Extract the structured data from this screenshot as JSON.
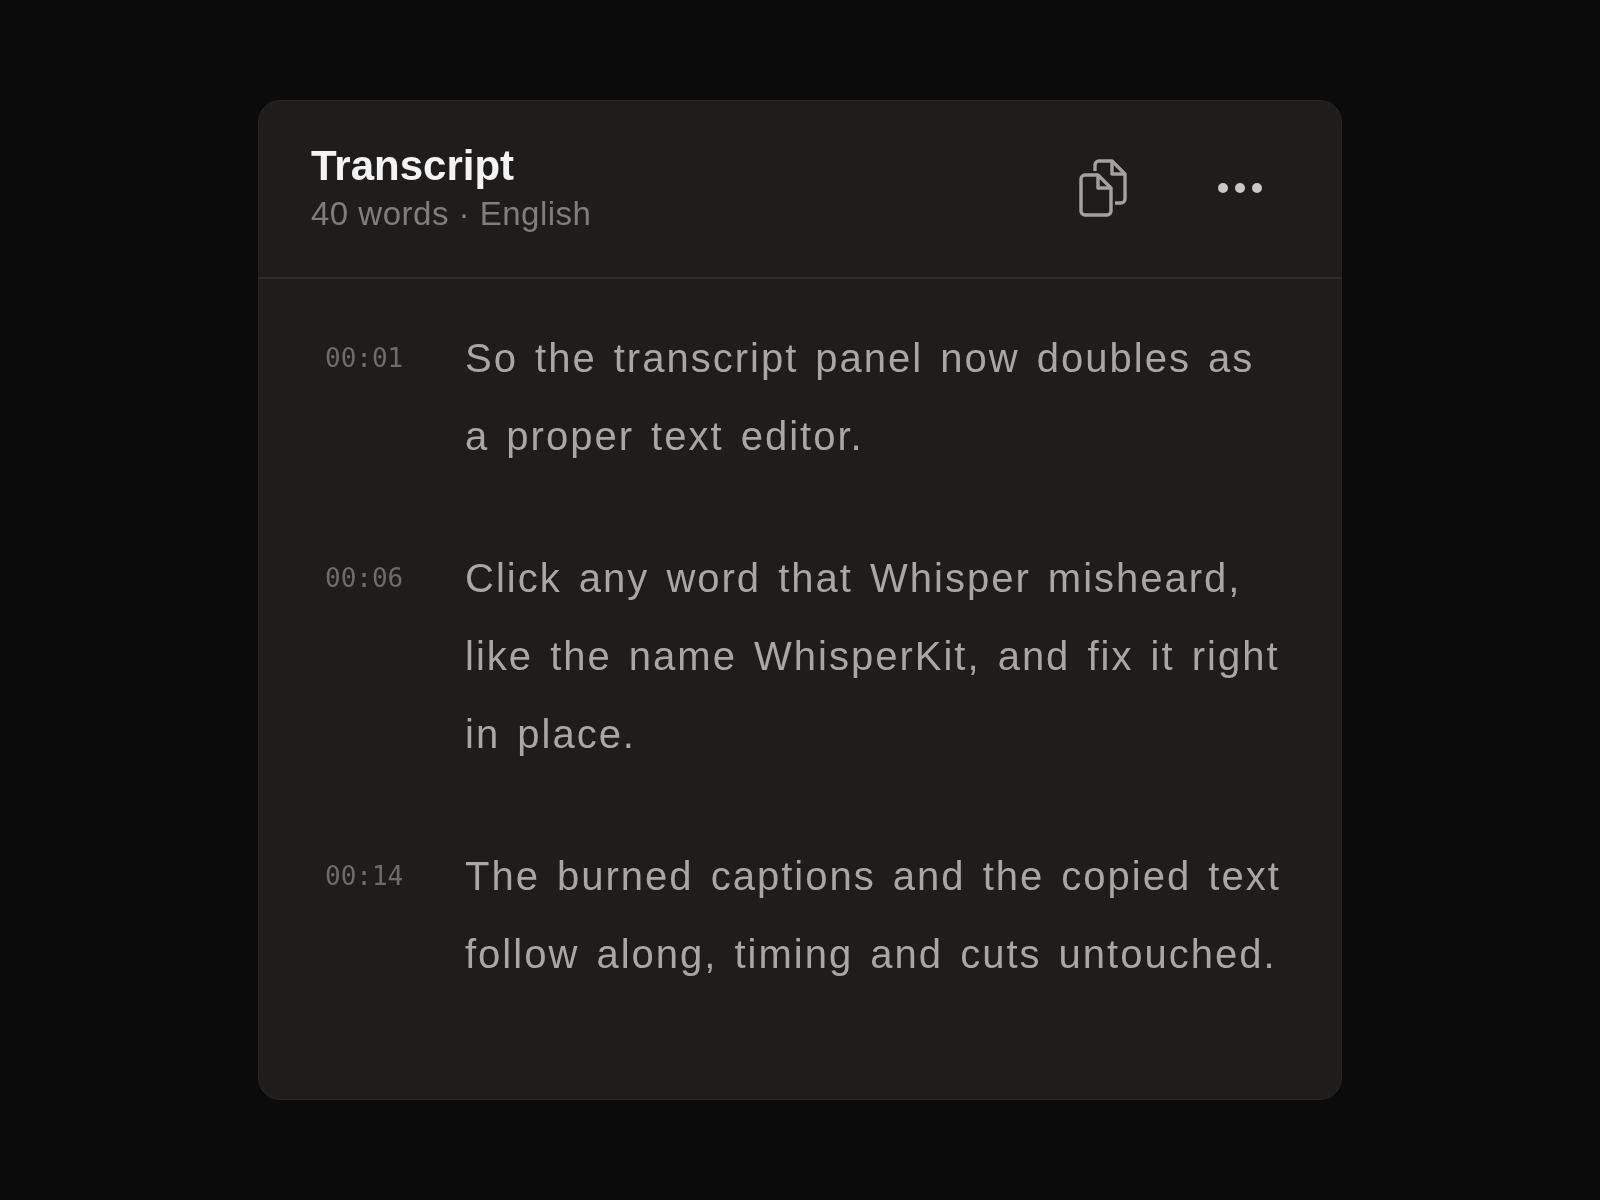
{
  "panel": {
    "title": "Transcript",
    "subtitle": "40 words · English"
  },
  "segments": [
    {
      "time": "00:01",
      "text": "So the transcript panel now doubles as a proper text editor."
    },
    {
      "time": "00:06",
      "text": "Click any word that Whisper misheard, like the name WhisperKit, and fix it right in place."
    },
    {
      "time": "00:14",
      "text": "The burned captions and the copied text follow along, timing and cuts untouched."
    }
  ]
}
